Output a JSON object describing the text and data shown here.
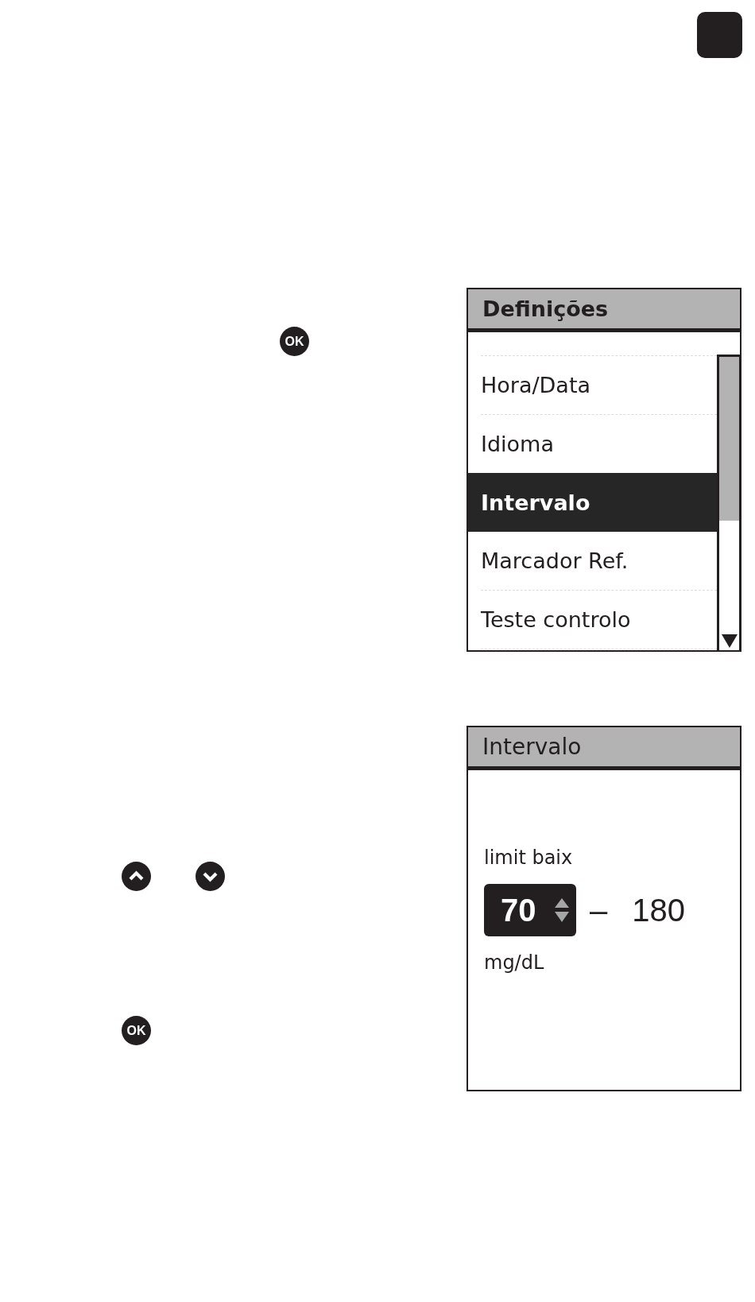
{
  "sections": [
    {
      "key_rows": [
        [
          {
            "kind": "ok",
            "label": "OK"
          }
        ]
      ],
      "screen": {
        "kind": "menu",
        "title": "Definições",
        "items": [
          {
            "label": "Hora/Data",
            "selected": false
          },
          {
            "label": "Idioma",
            "selected": false
          },
          {
            "label": "Intervalo",
            "selected": true
          },
          {
            "label": "Marcador Ref.",
            "selected": false
          },
          {
            "label": "Teste controlo",
            "selected": false
          }
        ]
      }
    },
    {
      "key_rows": [
        [
          {
            "kind": "up"
          },
          {
            "kind": "down"
          }
        ],
        [
          {
            "kind": "ok",
            "label": "OK"
          }
        ]
      ],
      "screen": {
        "kind": "range",
        "title": "Intervalo",
        "caption": "limit baix",
        "low": "70",
        "separator": "–",
        "high": "180",
        "unit": "mg/dL"
      }
    }
  ]
}
